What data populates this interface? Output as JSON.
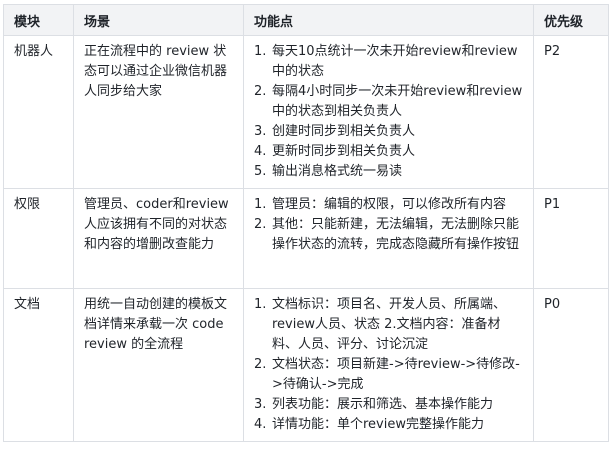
{
  "headers": {
    "module": "模块",
    "scene": "场景",
    "features": "功能点",
    "priority": "优先级"
  },
  "rows": [
    {
      "module": "机器人",
      "scene": "正在流程中的 review 状态可以通过企业微信机器人同步给大家",
      "features": [
        "每天10点统计一次未开始review和review中的状态",
        "每隔4小时同步一次未开始review和review中的状态到相关负责人",
        "创建时同步到相关负责人",
        "更新时同步到相关负责人",
        "输出消息格式统一易读"
      ],
      "priority": "P2"
    },
    {
      "module": "权限",
      "scene": "管理员、coder和review人应该拥有不同的对状态和内容的增删改查能力",
      "features": [
        "管理员：编辑的权限，可以修改所有内容",
        "其他：只能新建，无法编辑，无法删除只能操作状态的流转，完成态隐藏所有操作按钮"
      ],
      "priority": "P1"
    },
    {
      "module": "文档",
      "scene": "用统一自动创建的模板文档详情来承载一次 code review 的全流程",
      "features": [
        "文档标识：项目名、开发人员、所属端、review人员、状态 2.文档内容：准备材料、人员、评分、讨论沉淀",
        "文档状态：项目新建->待review->待修改->待确认->完成",
        "列表功能：展示和筛选、基本操作能力",
        "详情功能：单个review完整操作能力"
      ],
      "priority": "P0"
    }
  ]
}
